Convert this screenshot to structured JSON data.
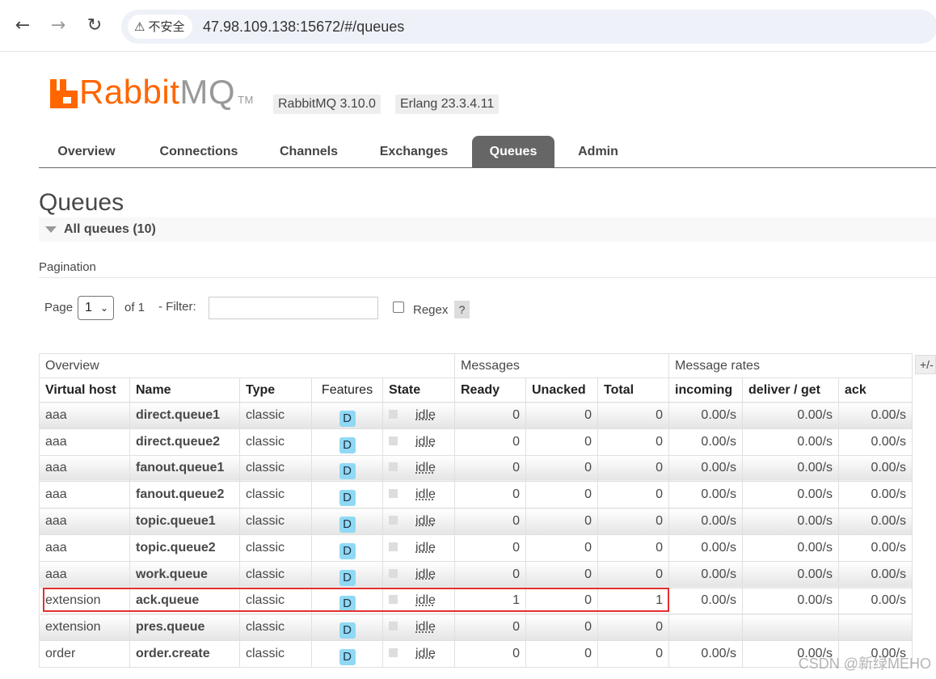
{
  "browser": {
    "security_label": "不安全",
    "url": "47.98.109.138:15672/#/queues"
  },
  "header": {
    "logo_rabbit": "Rabbit",
    "logo_mq": "MQ",
    "logo_tm": "TM",
    "rabbitmq_version": "RabbitMQ 3.10.0",
    "erlang_version": "Erlang 23.3.4.11"
  },
  "tabs": [
    {
      "label": "Overview"
    },
    {
      "label": "Connections"
    },
    {
      "label": "Channels"
    },
    {
      "label": "Exchanges"
    },
    {
      "label": "Queues",
      "active": true
    },
    {
      "label": "Admin"
    }
  ],
  "page": {
    "title": "Queues",
    "section_label": "All queues (10)"
  },
  "pagination": {
    "label": "Pagination",
    "page_label": "Page",
    "page_value": "1",
    "of_label": "of 1",
    "filter_label": "- Filter:",
    "filter_value": "",
    "regex_label": "Regex",
    "help_label": "?",
    "columns_toggle": "+/-"
  },
  "table": {
    "groups": [
      "Overview",
      "Messages",
      "Message rates"
    ],
    "columns": [
      "Virtual host",
      "Name",
      "Type",
      "Features",
      "State",
      "Ready",
      "Unacked",
      "Total",
      "incoming",
      "deliver / get",
      "ack"
    ],
    "rows": [
      {
        "vhost": "aaa",
        "name": "direct.queue1",
        "type": "classic",
        "feature": "D",
        "state": "idle",
        "ready": "0",
        "unacked": "0",
        "total": "0",
        "incoming": "0.00/s",
        "deliver": "0.00/s",
        "ack": "0.00/s"
      },
      {
        "vhost": "aaa",
        "name": "direct.queue2",
        "type": "classic",
        "feature": "D",
        "state": "idle",
        "ready": "0",
        "unacked": "0",
        "total": "0",
        "incoming": "0.00/s",
        "deliver": "0.00/s",
        "ack": "0.00/s"
      },
      {
        "vhost": "aaa",
        "name": "fanout.queue1",
        "type": "classic",
        "feature": "D",
        "state": "idle",
        "ready": "0",
        "unacked": "0",
        "total": "0",
        "incoming": "0.00/s",
        "deliver": "0.00/s",
        "ack": "0.00/s"
      },
      {
        "vhost": "aaa",
        "name": "fanout.queue2",
        "type": "classic",
        "feature": "D",
        "state": "idle",
        "ready": "0",
        "unacked": "0",
        "total": "0",
        "incoming": "0.00/s",
        "deliver": "0.00/s",
        "ack": "0.00/s"
      },
      {
        "vhost": "aaa",
        "name": "topic.queue1",
        "type": "classic",
        "feature": "D",
        "state": "idle",
        "ready": "0",
        "unacked": "0",
        "total": "0",
        "incoming": "0.00/s",
        "deliver": "0.00/s",
        "ack": "0.00/s"
      },
      {
        "vhost": "aaa",
        "name": "topic.queue2",
        "type": "classic",
        "feature": "D",
        "state": "idle",
        "ready": "0",
        "unacked": "0",
        "total": "0",
        "incoming": "0.00/s",
        "deliver": "0.00/s",
        "ack": "0.00/s"
      },
      {
        "vhost": "aaa",
        "name": "work.queue",
        "type": "classic",
        "feature": "D",
        "state": "idle",
        "ready": "0",
        "unacked": "0",
        "total": "0",
        "incoming": "0.00/s",
        "deliver": "0.00/s",
        "ack": "0.00/s"
      },
      {
        "vhost": "extension",
        "name": "ack.queue",
        "type": "classic",
        "feature": "D",
        "state": "idle",
        "ready": "1",
        "unacked": "0",
        "total": "1",
        "incoming": "0.00/s",
        "deliver": "0.00/s",
        "ack": "0.00/s"
      },
      {
        "vhost": "extension",
        "name": "pres.queue",
        "type": "classic",
        "feature": "D",
        "state": "idle",
        "ready": "0",
        "unacked": "0",
        "total": "0",
        "incoming": "",
        "deliver": "",
        "ack": ""
      },
      {
        "vhost": "order",
        "name": "order.create",
        "type": "classic",
        "feature": "D",
        "state": "idle",
        "ready": "0",
        "unacked": "0",
        "total": "0",
        "incoming": "0.00/s",
        "deliver": "0.00/s",
        "ack": "0.00/s"
      }
    ]
  },
  "watermark": "CSDN @新绿MEHO"
}
